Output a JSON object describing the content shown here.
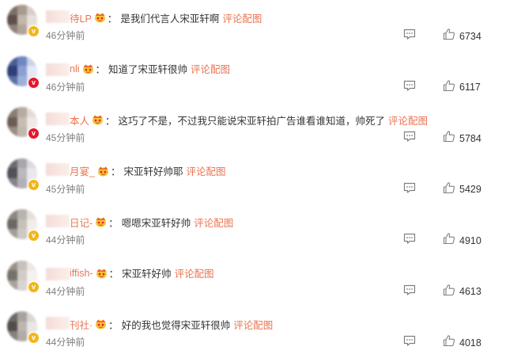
{
  "colors": {
    "username": "#eb7350",
    "link": "#eb7350",
    "text": "#333333",
    "meta": "#808080",
    "badge_yellow": "#f3b617",
    "badge_red": "#e6162d"
  },
  "comments": [
    {
      "username": "待LP",
      "text": "是我们代言人宋亚轩啊",
      "reply_link": "评论配图",
      "time": "46分钟前",
      "likes": "6734",
      "badge": "yellow",
      "avatar_colors": [
        "#7d6f66",
        "#a79a8f",
        "#d6cec7",
        "#5e5048",
        "#c3b6ab",
        "#e6e0db",
        "#8f8279",
        "#b1a59a",
        "#ede9e5"
      ]
    },
    {
      "username": "nli",
      "text": "知道了宋亚轩很帅",
      "reply_link": "评论配图",
      "time": "46分钟前",
      "likes": "6117",
      "badge": "red",
      "avatar_colors": [
        "#4a5f9a",
        "#6f86c2",
        "#c9d2e8",
        "#2f3f78",
        "#8ba0d2",
        "#e4e9f5",
        "#5a6fa8",
        "#9eafdb",
        "#dfe4f1"
      ]
    },
    {
      "username": "本人",
      "text": "这巧了不是，不过我只能说宋亚轩拍广告谁看谁知道，帅死了",
      "reply_link": "评论配图",
      "time": "45分钟前",
      "likes": "5784",
      "badge": "red",
      "avatar_colors": [
        "#8a7d74",
        "#b7aba1",
        "#e2dbd5",
        "#6b5d54",
        "#c8bdb3",
        "#efeae6",
        "#9a8d84",
        "#c2b7ad",
        "#f0ece8"
      ]
    },
    {
      "username": "月宴_",
      "text": "宋亚轩好帅耶",
      "reply_link": "评论配图",
      "time": "45分钟前",
      "likes": "5429",
      "badge": "yellow",
      "avatar_colors": [
        "#6d6a70",
        "#aaa5ad",
        "#dcd8de",
        "#54505a",
        "#bdb8c0",
        "#ebe8ec",
        "#858189",
        "#b3afb6",
        "#eeecef"
      ]
    },
    {
      "username": "日记-",
      "text": "嗯嗯宋亚轩好帅",
      "reply_link": "评论配图",
      "time": "44分钟前",
      "likes": "4910",
      "badge": "yellow",
      "avatar_colors": [
        "#8c8782",
        "#b9b3ad",
        "#e3dfdb",
        "#6c6762",
        "#c6c0ba",
        "#f0edea",
        "#a39d97",
        "#cdc8c3",
        "#f2efec"
      ]
    },
    {
      "username": "iffish-",
      "text": "宋亚轩好帅",
      "reply_link": "评论配图",
      "time": "44分钟前",
      "likes": "4613",
      "badge": "yellow",
      "avatar_colors": [
        "#9b948e",
        "#c7c1bb",
        "#ebe7e3",
        "#77716b",
        "#d2ccc6",
        "#f4f1ee",
        "#a9a29c",
        "#d9d4cf",
        "#f6f3f1"
      ]
    },
    {
      "username": "刊社·",
      "text": "好的我也觉得宋亚轩很帅",
      "reply_link": "评论配图",
      "time": "44分钟前",
      "likes": "4018",
      "badge": "yellow",
      "avatar_colors": [
        "#6f6a66",
        "#a9a39e",
        "#dad5d1",
        "#524d49",
        "#bcb6b1",
        "#e9e6e3",
        "#87817c",
        "#b1aba6",
        "#ecebe9"
      ]
    }
  ]
}
